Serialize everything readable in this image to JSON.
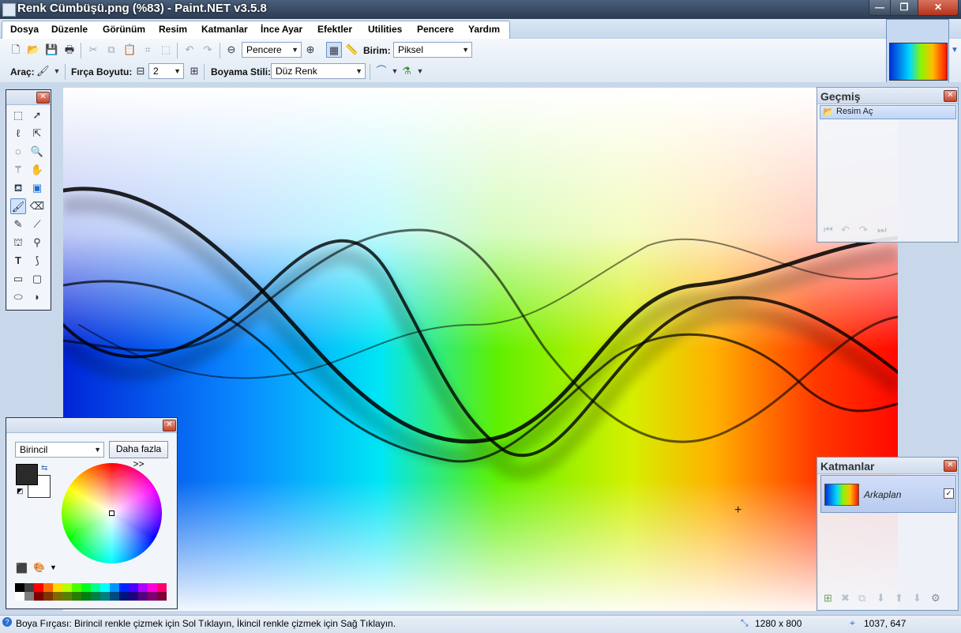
{
  "window": {
    "title": "Renk Cümbüşü.png (%83) - Paint.NET v3.5.8",
    "controls": {
      "minimize": "—",
      "maximize": "❐",
      "close": "✕"
    }
  },
  "menu": [
    "Dosya",
    "Düzenle",
    "Görünüm",
    "Resim",
    "Katmanlar",
    "İnce Ayar",
    "Efektler",
    "Utilities",
    "Pencere",
    "Yardım"
  ],
  "toolbar": {
    "zoom_value": "Pencere",
    "unit_label": "Birim:",
    "unit_value": "Piksel",
    "tool_label": "Araç:",
    "brush_size_label": "Fırça Boyutu:",
    "brush_size_value": "2",
    "fill_style_label": "Boyama Stili:",
    "fill_style_value": "Düz Renk"
  },
  "history": {
    "title": "Geçmiş",
    "items": [
      "Resim Aç"
    ]
  },
  "layers": {
    "title": "Katmanlar",
    "items": [
      {
        "name": "Arkaplan",
        "visible": true
      }
    ]
  },
  "colors": {
    "mode": "Birincil",
    "more_button": "Daha fazla >>",
    "primary": "#2a2a2a",
    "secondary": "#ffffff",
    "palette_row1": [
      "#000000",
      "#404040",
      "#ff0000",
      "#ff6a00",
      "#ffd800",
      "#b6ff00",
      "#4cff00",
      "#00ff21",
      "#00ff90",
      "#00ffff",
      "#0094ff",
      "#0026ff",
      "#4800ff",
      "#b200ff",
      "#ff00dc",
      "#ff006e"
    ],
    "palette_row2": [
      "#ffffff",
      "#808080",
      "#7f0000",
      "#7f3300",
      "#7f6a00",
      "#5b7f00",
      "#267f00",
      "#007f0e",
      "#007f46",
      "#007f7f",
      "#004a7f",
      "#00137f",
      "#21007f",
      "#57007f",
      "#7f006e",
      "#7f0037"
    ]
  },
  "status": {
    "message": "Boya Fırçası: Birincil renkle çizmek için Sol Tıklayın, İkincil renkle çizmek için Sağ Tıklayın.",
    "image_size": "1280 x 800",
    "cursor_position": "1037, 647"
  }
}
